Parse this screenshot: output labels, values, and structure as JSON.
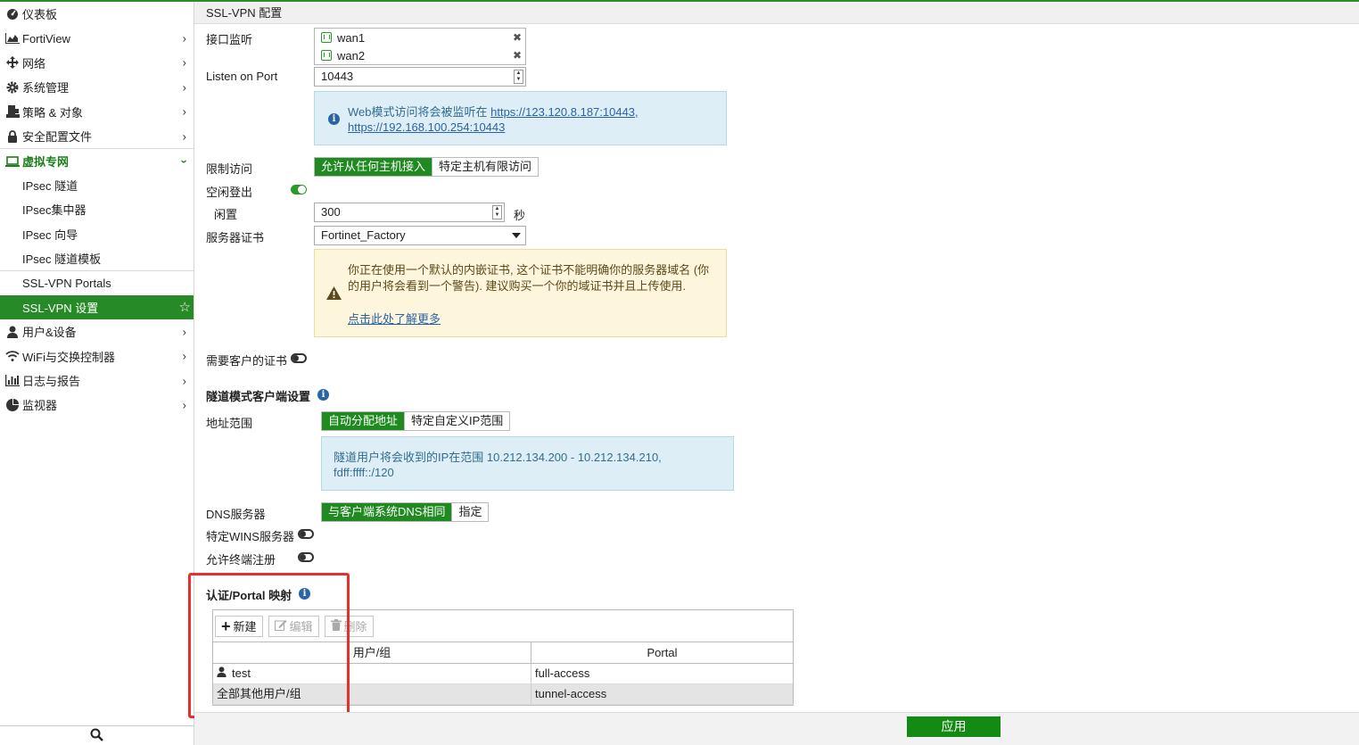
{
  "sidebar": {
    "items": [
      {
        "label": "仪表板",
        "icon": "dashboard-icon"
      },
      {
        "label": "FortiView",
        "icon": "chart-icon"
      },
      {
        "label": "网络",
        "icon": "network-icon"
      },
      {
        "label": "系统管理",
        "icon": "gear-icon"
      },
      {
        "label": "策略 & 对象",
        "icon": "policy-icon"
      },
      {
        "label": "安全配置文件",
        "icon": "lock-icon"
      },
      {
        "label": "虚拟专网",
        "icon": "laptop-icon"
      },
      {
        "label": "IPsec 隧道"
      },
      {
        "label": "IPsec集中器"
      },
      {
        "label": "IPsec 向导"
      },
      {
        "label": "IPsec 隧道模板"
      },
      {
        "label": "SSL-VPN Portals"
      },
      {
        "label": "SSL-VPN 设置"
      },
      {
        "label": "用户&设备",
        "icon": "user-icon"
      },
      {
        "label": "WiFi与交换控制器",
        "icon": "wifi-icon"
      },
      {
        "label": "日志与报告",
        "icon": "log-icon"
      },
      {
        "label": "监视器",
        "icon": "monitor-icon"
      }
    ]
  },
  "header": {
    "title": "SSL-VPN 配置"
  },
  "form": {
    "interface_label": "接口监听",
    "interfaces": [
      "wan1",
      "wan2"
    ],
    "port_label": "Listen on Port",
    "port_value": "10443",
    "web_info_text": "Web模式访问将会被监听在",
    "web_info_url1": "https://123.120.8.187:10443,",
    "web_info_url2": "https://192.168.100.254:10443",
    "restrict_label": "限制访问",
    "restrict_on": "允许从任何主机接入",
    "restrict_off": "特定主机有限访问",
    "idle_logout_label": "空闲登出",
    "idle_label": "闲置",
    "idle_value": "300",
    "idle_unit": "秒",
    "cert_label": "服务器证书",
    "cert_value": "Fortinet_Factory",
    "warn_text": "你正在使用一个默认的内嵌证书, 这个证书不能明确你的服务器域名 (你的用户将会看到一个警告). 建议购买一个你的域证书并且上传使用.",
    "warn_link": "点击此处了解更多",
    "client_cert_label": "需要客户的证书",
    "tunnel_section": "隧道模式客户端设置",
    "addr_label": "地址范围",
    "addr_on": "自动分配地址",
    "addr_off": "特定自定义IP范围",
    "tunnel_info_line1": "隧道用户将会收到的IP在范围 10.212.134.200 - 10.212.134.210,",
    "tunnel_info_line2": "fdff:ffff::/120",
    "dns_label": "DNS服务器",
    "dns_on": "与客户端系统DNS相同",
    "dns_off": "指定",
    "wins_label": "特定WINS服务器",
    "endpoint_label": "允许终端注册",
    "auth_section": "认证/Portal 映射"
  },
  "table": {
    "new_btn": "新建",
    "edit_btn": "编辑",
    "delete_btn": "删除",
    "columns": [
      "用户/组",
      "Portal"
    ],
    "rows": [
      {
        "user": "test",
        "portal": "full-access"
      },
      {
        "user": "全部其他用户/组",
        "portal": "tunnel-access"
      }
    ]
  },
  "apply_label": "应用",
  "colors": {
    "accent": "#1f8a1f",
    "highlight": "#e53030"
  }
}
